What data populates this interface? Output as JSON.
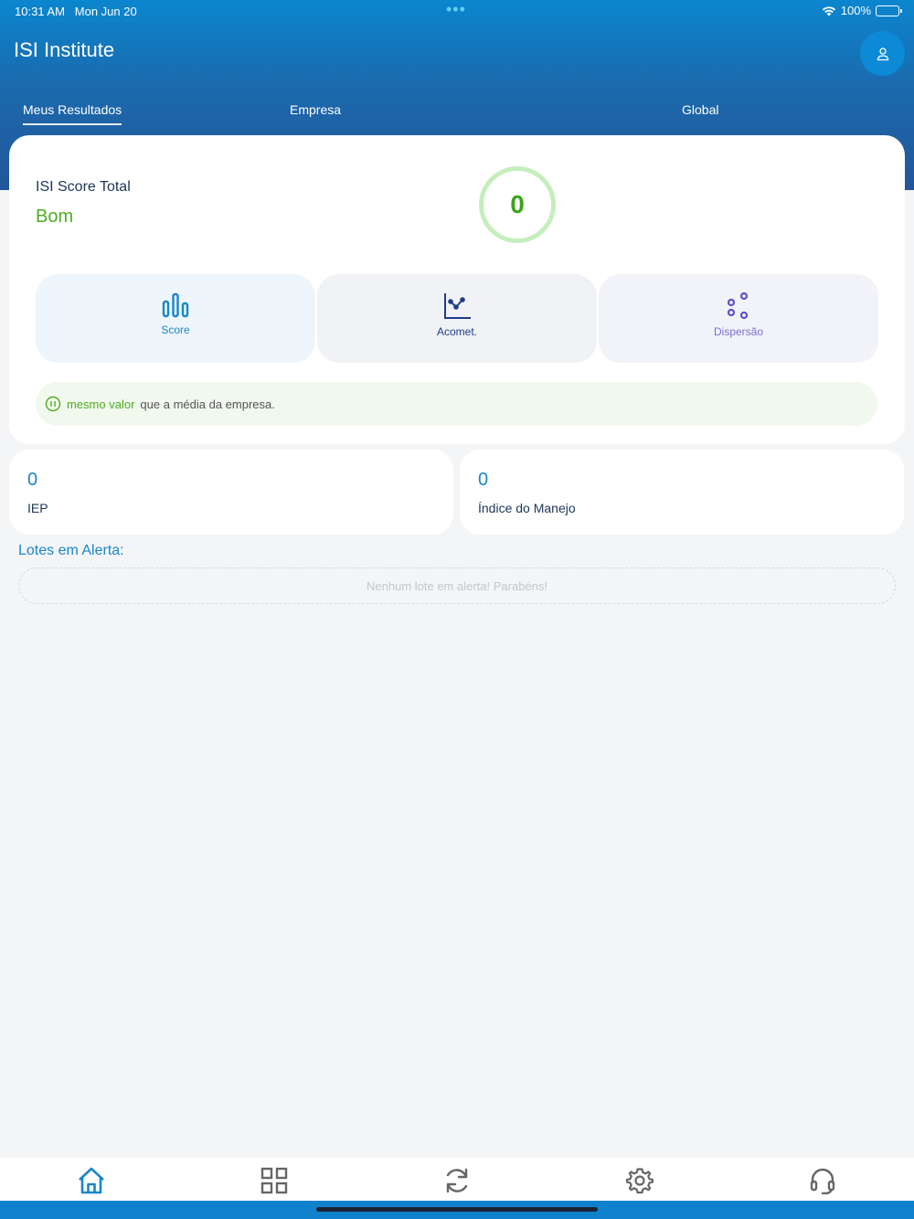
{
  "status_bar": {
    "time": "10:31 AM",
    "date": "Mon Jun 20",
    "battery": "100%",
    "icons": [
      "wifi-icon",
      "battery-icon"
    ]
  },
  "header": {
    "title": "ISI Institute",
    "profile_icon": "user-icon",
    "colors": {
      "gradient_top": "#0b86cf",
      "gradient_bottom": "#23569a"
    }
  },
  "tabs": [
    {
      "label": "Meus Resultados",
      "active": true
    },
    {
      "label": "Empresa",
      "active": false
    },
    {
      "label": "Global",
      "active": false
    }
  ],
  "score_card": {
    "label": "ISI Score Total",
    "status": "Bom",
    "score": "0",
    "status_color": "#4cae1f",
    "buttons": [
      {
        "label": "Score",
        "icon": "bar-chart-icon"
      },
      {
        "label": "Acomet.",
        "icon": "line-chart-icon"
      },
      {
        "label": "Dispersão",
        "icon": "scatter-icon"
      }
    ],
    "comparison": {
      "icon": "pause-circle-icon",
      "highlight": "mesmo valor",
      "text": "que a média da empresa."
    }
  },
  "kpis": [
    {
      "value": "0",
      "label": "IEP"
    },
    {
      "value": "0",
      "label": "Índice do Manejo"
    }
  ],
  "alerts": {
    "title": "Lotes em Alerta:",
    "empty_message": "Nenhum lote em alerta! Parabéns!"
  },
  "bottom_nav": [
    {
      "icon": "home-icon",
      "active": true
    },
    {
      "icon": "grid-icon",
      "active": false
    },
    {
      "icon": "refresh-icon",
      "active": false
    },
    {
      "icon": "gear-icon",
      "active": false
    },
    {
      "icon": "headset-icon",
      "active": false
    }
  ]
}
